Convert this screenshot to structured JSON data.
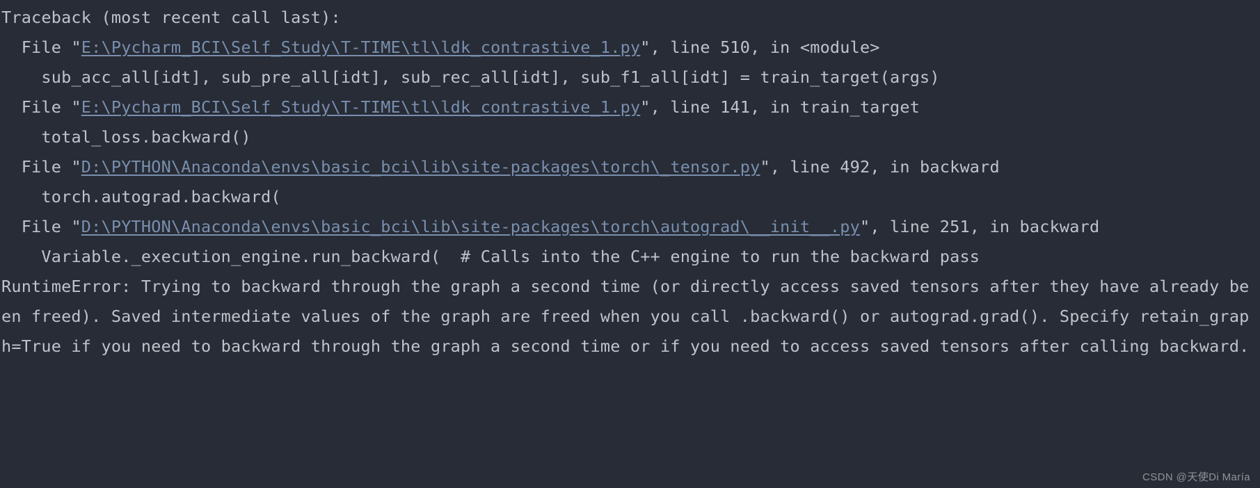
{
  "traceback": {
    "header": "Traceback (most recent call last):",
    "frames": [
      {
        "prefix": "  File \"",
        "path": "E:\\Pycharm_BCI\\Self_Study\\T-TIME\\tl\\ldk_contrastive_1.py",
        "suffix": "\", line 510, in <module>",
        "code": "    sub_acc_all[idt], sub_pre_all[idt], sub_rec_all[idt], sub_f1_all[idt] = train_target(args)"
      },
      {
        "prefix": "  File \"",
        "path": "E:\\Pycharm_BCI\\Self_Study\\T-TIME\\tl\\ldk_contrastive_1.py",
        "suffix": "\", line 141, in train_target",
        "code": "    total_loss.backward()"
      },
      {
        "prefix": "  File \"",
        "path": "D:\\PYTHON\\Anaconda\\envs\\basic_bci\\lib\\site-packages\\torch\\_tensor.py",
        "suffix": "\", line 492, in backward",
        "code": "    torch.autograd.backward("
      },
      {
        "prefix": "  File \"",
        "path": "D:\\PYTHON\\Anaconda\\envs\\basic_bci\\lib\\site-packages\\torch\\autograd\\__init__.py",
        "suffix": "\", line 251, in backward",
        "code": "    Variable._execution_engine.run_backward(  # Calls into the C++ engine to run the backward pass"
      }
    ],
    "error": "RuntimeError: Trying to backward through the graph a second time (or directly access saved tensors after they have already been freed). Saved intermediate values of the graph are freed when you call .backward() or autograd.grad(). Specify retain_graph=True if you need to backward through the graph a second time or if you need to access saved tensors after calling backward."
  },
  "watermark": "CSDN @天使Di María"
}
